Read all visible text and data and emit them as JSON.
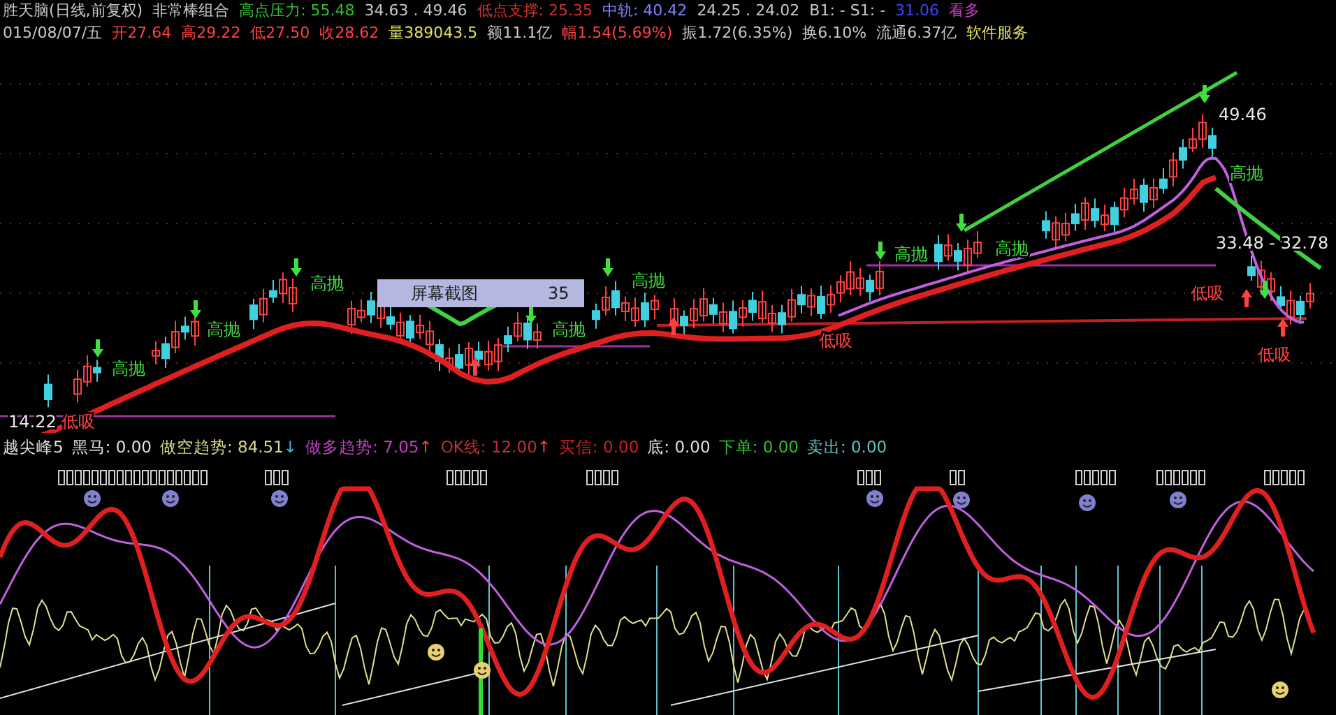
{
  "header": {
    "line1": [
      {
        "text": "胜天脑(日线,前复权)",
        "color": "#c8c8c8"
      },
      {
        "text": "非常棒组合",
        "color": "#c8c8c8"
      },
      {
        "text": "高点压力: 55.48",
        "color": "#30c030"
      },
      {
        "text": "34.63 . 49.46",
        "color": "#c8c8c8"
      },
      {
        "text": "低点支撑: 25.35",
        "color": "#d03030"
      },
      {
        "text": "中轨: 40.42",
        "color": "#8080ff"
      },
      {
        "text": "24.25 . 24.02",
        "color": "#c8c8c8"
      },
      {
        "text": "B1: - S1: -",
        "color": "#c8c8c8"
      },
      {
        "text": "31.06",
        "color": "#4040ff"
      },
      {
        "text": "看多",
        "color": "#c040c0"
      }
    ],
    "line2": [
      {
        "text": "015/08/07/五",
        "color": "#c8c8c8"
      },
      {
        "text": "开27.64",
        "color": "#ff4040"
      },
      {
        "text": "高29.22",
        "color": "#ff4040"
      },
      {
        "text": "低27.50",
        "color": "#ff4040"
      },
      {
        "text": "收28.62",
        "color": "#ff4040"
      },
      {
        "text": "量389043.5",
        "color": "#e0e060"
      },
      {
        "text": "额11.1亿",
        "color": "#c8c8c8"
      },
      {
        "text": "幅1.54(5.69%)",
        "color": "#ff4040"
      },
      {
        "text": "振1.72(6.35%)",
        "color": "#c8c8c8"
      },
      {
        "text": "换6.10%",
        "color": "#c8c8c8"
      },
      {
        "text": "流通6.37亿",
        "color": "#c8c8c8"
      },
      {
        "text": "软件服务",
        "color": "#e0e060"
      }
    ]
  },
  "chart_labels": [
    {
      "text": "高抛",
      "kind": "sell"
    },
    {
      "text": "高抛",
      "kind": "sell"
    },
    {
      "text": "高抛",
      "kind": "sell"
    },
    {
      "text": "高抛",
      "kind": "sell"
    },
    {
      "text": "高抛",
      "kind": "sell"
    },
    {
      "text": "高抛",
      "kind": "sell"
    },
    {
      "text": "高抛",
      "kind": "sell"
    },
    {
      "text": "高抛",
      "kind": "sell"
    },
    {
      "text": "14.22",
      "kind": "price"
    },
    {
      "text": "低吸",
      "kind": "buy"
    },
    {
      "text": "低吸",
      "kind": "buy"
    },
    {
      "text": "低吸",
      "kind": "buy"
    },
    {
      "text": "低吸",
      "kind": "buy"
    },
    {
      "text": "49.46",
      "kind": "price"
    },
    {
      "text": "33.48 - 32.78",
      "kind": "price"
    }
  ],
  "popup": {
    "title": "屏幕截图",
    "value": "35"
  },
  "indicator": {
    "name": "越尖峰5",
    "values": [
      {
        "text": "黑马: 0.00",
        "color": "#e0e0e0"
      },
      {
        "text": "做空趋势: 84.51",
        "color": "#d8d890",
        "arrow": {
          "text": "↓",
          "color": "#40c0e0"
        }
      },
      {
        "text": "做多趋势: 7.05",
        "color": "#c040c0",
        "arrow": {
          "text": "↑",
          "color": "#ff4040"
        }
      },
      {
        "text": "OK线: 12.00",
        "color": "#c03030",
        "arrow": {
          "text": "↑",
          "color": "#ff4040"
        }
      },
      {
        "text": "买信: 0.00",
        "color": "#d02020"
      },
      {
        "text": "底: 0.00",
        "color": "#e0e0e0"
      },
      {
        "text": "下单: 0.00",
        "color": "#30c030"
      },
      {
        "text": "卖出: 0.00",
        "color": "#60c0c0"
      }
    ]
  }
}
